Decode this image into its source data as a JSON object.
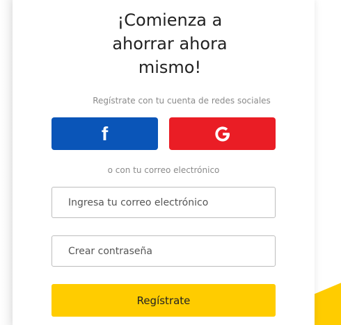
{
  "signup": {
    "title_lines": [
      "¡Comienza a",
      "ahorrar ahora",
      "mismo!"
    ],
    "social_prompt": "Regístrate con tu cuenta de redes sociales",
    "facebook_label": "f",
    "email_prompt": "o con tu correo electrónico",
    "email_placeholder": "Ingresa tu correo electrónico",
    "password_placeholder": "Crear contraseña",
    "submit_label": "Regístrate"
  },
  "colors": {
    "facebook": "#0a55b8",
    "google": "#ea1d25",
    "accent_yellow": "#ffcc00"
  },
  "icons": {
    "facebook": "facebook-icon",
    "google": "google-icon"
  }
}
